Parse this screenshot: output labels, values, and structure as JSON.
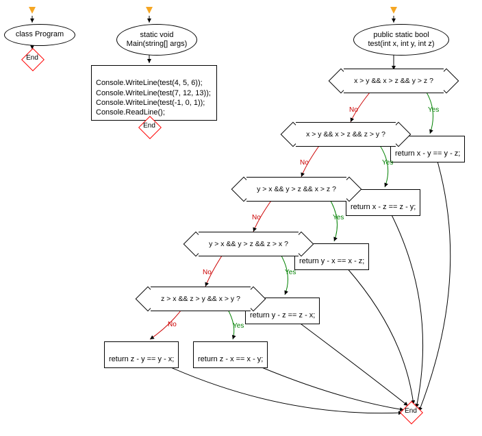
{
  "flowchart": {
    "col1": {
      "entry_label": "class Program"
    },
    "col2": {
      "entry_label": "static void\nMain(string[] args)",
      "body": "Console.WriteLine(test(4, 5, 6));\nConsole.WriteLine(test(7, 12, 13));\nConsole.WriteLine(test(-1, 0, 1));\nConsole.ReadLine();"
    },
    "col3": {
      "entry_label": "public static bool\ntest(int x, int y, int z)",
      "decisions": [
        {
          "condition": "x > y && x > z && y > z ?",
          "return": "return x - y == y - z;"
        },
        {
          "condition": "x > y && x > z && z > y ?",
          "return": "return x - z == z - y;"
        },
        {
          "condition": "y > x && y > z && x > z ?",
          "return": "return y - x == x - z;"
        },
        {
          "condition": "y > x && y > z && z > x ?",
          "return": "return y - z == z - x;"
        },
        {
          "condition": "z > x && z > y && x > y ?",
          "return": "return z - x == x - y;"
        }
      ],
      "final_return": "return z - y == y - x;"
    },
    "labels": {
      "yes": "Yes",
      "no": "No",
      "end": "End"
    }
  }
}
